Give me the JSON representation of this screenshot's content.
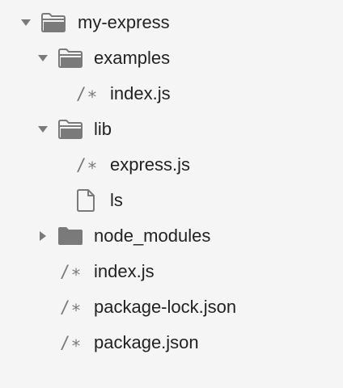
{
  "tree": {
    "root": {
      "label": "my-express",
      "icon": "open-folder-icon",
      "expanded": true
    },
    "examples": {
      "label": "examples",
      "icon": "open-folder-icon",
      "expanded": true
    },
    "examples_index": {
      "label": "index.js",
      "icon": "code-file-icon",
      "glyph": "/∗"
    },
    "lib": {
      "label": "lib",
      "icon": "open-folder-icon",
      "expanded": true
    },
    "lib_express": {
      "label": "express.js",
      "icon": "code-file-icon",
      "glyph": "/∗"
    },
    "lib_ls": {
      "label": "ls",
      "icon": "document-file-icon"
    },
    "node_modules": {
      "label": "node_modules",
      "icon": "closed-folder-icon",
      "expanded": false
    },
    "root_index": {
      "label": "index.js",
      "icon": "code-file-icon",
      "glyph": "/∗"
    },
    "package_lock": {
      "label": "package-lock.json",
      "icon": "code-file-icon",
      "glyph": "/∗"
    },
    "package_json": {
      "label": "package.json",
      "icon": "code-file-icon",
      "glyph": "/∗"
    }
  },
  "colors": {
    "background": "#f5f5f5",
    "text": "#222222",
    "icon": "#7a7a7a"
  }
}
